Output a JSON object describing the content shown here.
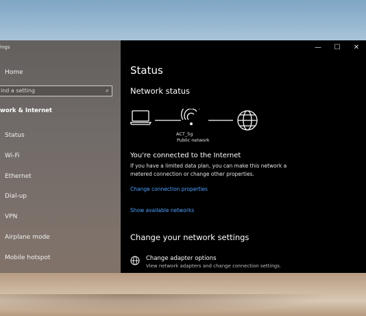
{
  "window": {
    "title": "ings",
    "controls": {
      "minimize": "—",
      "maximize": "☐",
      "close": "✕"
    }
  },
  "sidebar": {
    "home_label": "Home",
    "search_placeholder": "ind a setting",
    "section_label": "work & Internet",
    "items": [
      {
        "label": "Status"
      },
      {
        "label": "Wi-Fi"
      },
      {
        "label": "Ethernet"
      },
      {
        "label": "Dial-up"
      },
      {
        "label": "VPN"
      },
      {
        "label": "Airplane mode"
      },
      {
        "label": "Mobile hotspot"
      }
    ]
  },
  "main": {
    "title": "Status",
    "network_status_heading": "Network status",
    "network_name": "ACT_5g",
    "network_type": "Public network",
    "connected_title": "You're connected to the Internet",
    "connected_desc": "If you have a limited data plan, you can make this network a metered connection or change other properties.",
    "link_change_props": "Change connection properties",
    "link_show_networks": "Show available networks",
    "change_settings_heading": "Change your network settings",
    "adapter_title": "Change adapter options",
    "adapter_desc": "View network adapters and change connection settings."
  },
  "colors": {
    "link": "#4ea0ff",
    "content_bg": "#000000",
    "sidebar_bg": "#5f5854"
  },
  "icons": [
    "search-icon",
    "laptop-icon",
    "wifi-icon",
    "globe-icon",
    "adapter-icon"
  ]
}
